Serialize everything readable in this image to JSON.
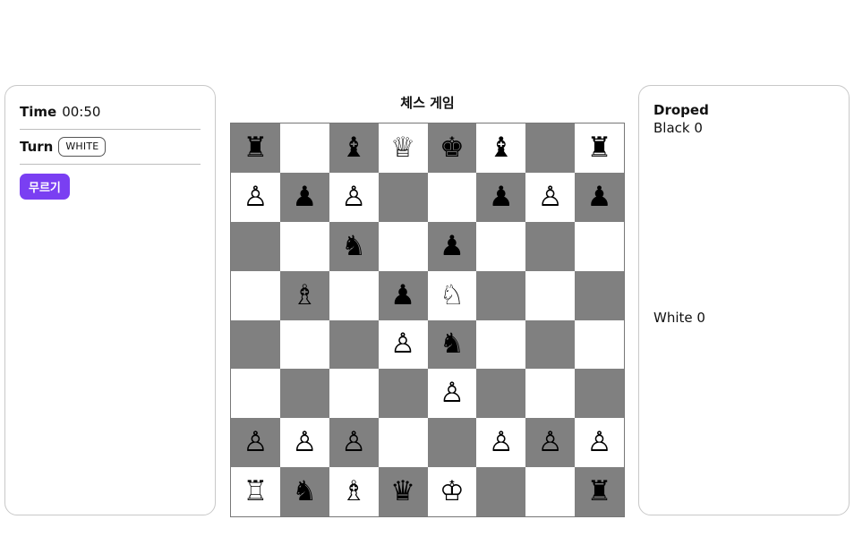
{
  "left": {
    "time_label": "Time",
    "time_value": "00:50",
    "turn_label": "Turn",
    "turn_value": "WHITE",
    "undo_label": "무르기"
  },
  "board": {
    "title": "체스 게임",
    "colors": {
      "dark": "#808080",
      "light": "#ffffff",
      "accent": "#7a3ff2"
    },
    "rows": [
      [
        "♜",
        "",
        "♝",
        "♕",
        "♚",
        "♝",
        "",
        "♜"
      ],
      [
        "♙",
        "♟",
        "♙",
        "",
        "",
        "♟",
        "♙",
        "♟"
      ],
      [
        "",
        "",
        "♞",
        "",
        "♟",
        "",
        "",
        ""
      ],
      [
        "",
        "♗",
        "",
        "♟",
        "♘",
        "",
        "",
        ""
      ],
      [
        "",
        "",
        "",
        "♙",
        "♞",
        "",
        "",
        ""
      ],
      [
        "",
        "",
        "",
        "",
        "♙",
        "",
        "",
        ""
      ],
      [
        "♙",
        "♙",
        "♙",
        "",
        "",
        "♙",
        "♙",
        "♙"
      ],
      [
        "♖",
        "♞",
        "♗",
        "♛",
        "♔",
        "",
        "",
        "♜"
      ]
    ]
  },
  "right": {
    "droped_label": "Droped",
    "black_count": "Black 0",
    "white_count": "White 0"
  }
}
